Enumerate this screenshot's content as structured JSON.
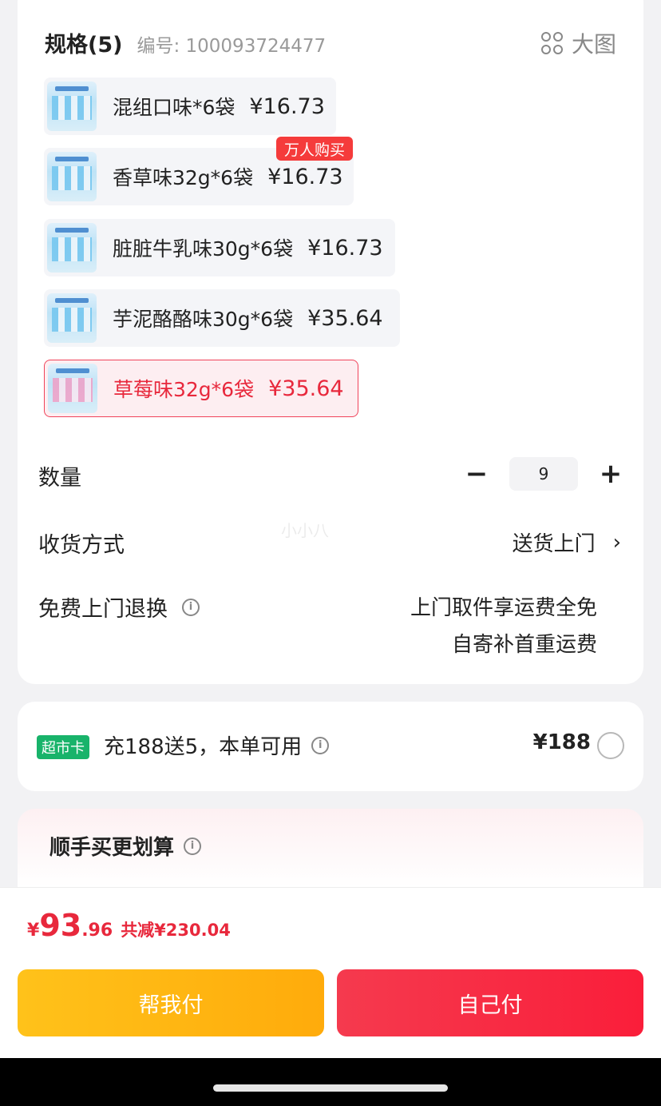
{
  "spec": {
    "title": "规格(5)",
    "code": "编号: 100093724477",
    "big_image_label": "大图",
    "options": [
      {
        "label": "混组口味*6袋",
        "price": "¥16.73"
      },
      {
        "label": "香草味32g*6袋",
        "price": "¥16.73",
        "badge": "万人购买"
      },
      {
        "label": "脏脏牛乳味30g*6袋",
        "price": "¥16.73"
      },
      {
        "label": "芋泥酪酪味30g*6袋",
        "price": "¥35.64"
      },
      {
        "label": "草莓味32g*6袋",
        "price": "¥35.64",
        "selected": true
      }
    ]
  },
  "quantity": {
    "label": "数量",
    "value": "9",
    "minus": "−",
    "plus": "+"
  },
  "delivery": {
    "label": "收货方式",
    "value": "送货上门",
    "chevron": "›"
  },
  "returns": {
    "label": "免费上门退换",
    "line1": "上门取件享运费全免",
    "line2": "自寄补首重运费"
  },
  "watermark": "小小八",
  "vip": {
    "tag": "超市卡",
    "text": "充188送5，本单可用",
    "price": "¥188"
  },
  "extra": {
    "title": "顺手买更划算"
  },
  "total": {
    "currency": "¥",
    "integer": "93",
    "decimal": ".96",
    "saved": "共减¥230.04"
  },
  "buttons": {
    "help": "帮我付",
    "self": "自己付"
  },
  "icons": {
    "info": "i",
    "accent_color": "#e8283c",
    "vip_color": "#18b36a"
  }
}
